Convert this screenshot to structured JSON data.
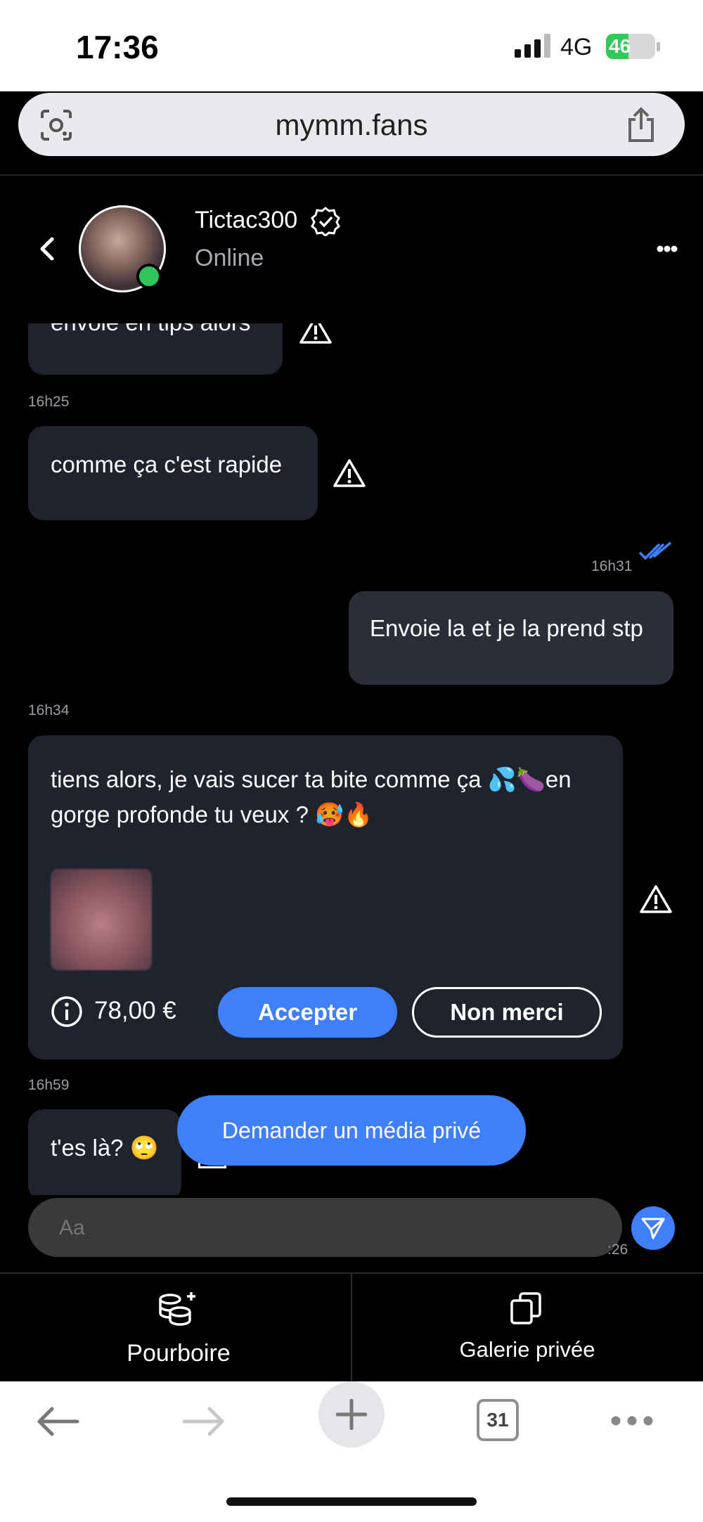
{
  "status_bar": {
    "time": "17:36",
    "network": "4G",
    "battery": "46",
    "battery_fraction": 0.46
  },
  "browser": {
    "url": "mymm.fans"
  },
  "chat_header": {
    "username": "Tictac300",
    "status": "Online"
  },
  "messages": [
    {
      "text": "envoie en tips alors",
      "side": "left"
    },
    {
      "time": "16h25",
      "text": "comme ça c'est rapide",
      "side": "left"
    },
    {
      "time": "16h31",
      "text": "Envoie la et je la prend stp",
      "side": "right"
    },
    {
      "time": "16h34",
      "text_line1": "tiens alors, je vais sucer ta bite comme ça 💦🍆en",
      "text_line2": "gorge profonde tu veux ? 🥵🔥",
      "side": "left",
      "price": "78,00 €",
      "accept_label": "Accepter",
      "decline_label": "Non merci"
    },
    {
      "time": "16h59",
      "text": "t'es là? 🙄",
      "side": "left"
    }
  ],
  "request_media_label": "Demander un média privé",
  "composer": {
    "placeholder": "Aa",
    "partial_time": ":26"
  },
  "actions": {
    "tip_label": "Pourboire",
    "gallery_label": "Galerie privée"
  },
  "nav": {
    "tab_count": "31"
  },
  "colors": {
    "accent": "#3f7ffa",
    "online": "#2fc55a",
    "bubble": "#1f232d"
  },
  "icons": [
    "camera-lens-icon",
    "share-icon",
    "back-chevron-icon",
    "verified-badge-icon",
    "more-dots-icon",
    "warning-icon",
    "info-icon",
    "send-icon",
    "coins-add-icon",
    "gallery-icon",
    "arrow-left-icon",
    "arrow-right-icon",
    "plus-icon"
  ]
}
